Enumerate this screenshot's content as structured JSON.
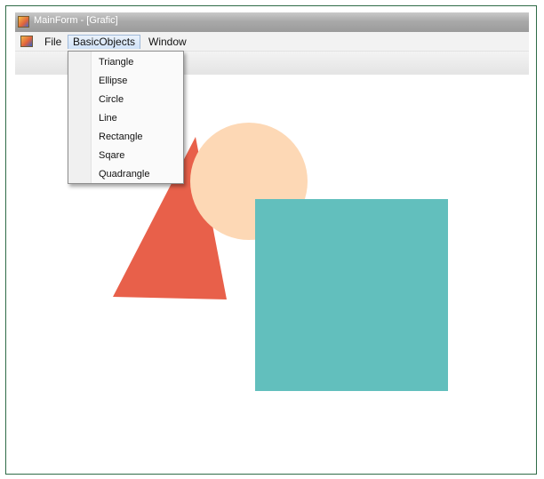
{
  "window": {
    "title": "MainForm - [Grafic]"
  },
  "menubar": {
    "items": [
      {
        "label": "File"
      },
      {
        "label": "BasicObjects",
        "active": true
      },
      {
        "label": "Window"
      }
    ]
  },
  "dropdown": {
    "items": [
      "Triangle",
      "Ellipse",
      "Circle",
      "Line",
      "Rectangle",
      "Sqare",
      "Quadrangle"
    ]
  },
  "shapes": {
    "triangle_color": "#e8604a",
    "circle_color": "#fdd8b5",
    "square_color": "#62bfbd"
  },
  "colors": {
    "frame": "#2f6b47",
    "titlebar": "#a9a9a9"
  }
}
